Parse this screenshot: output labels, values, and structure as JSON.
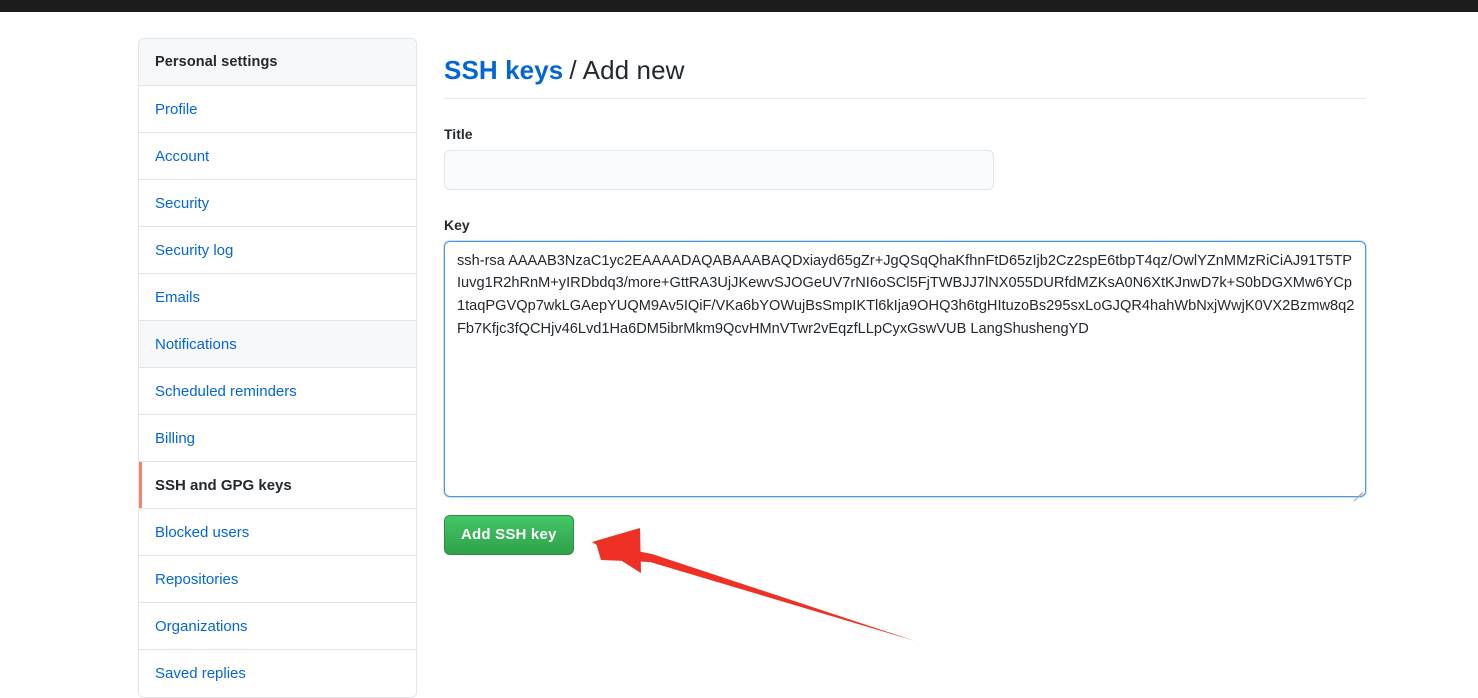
{
  "browser": {
    "chrome_color": "#1c1c1c"
  },
  "sidebar": {
    "header": "Personal settings",
    "items": [
      {
        "label": "Profile",
        "selected": false
      },
      {
        "label": "Account",
        "selected": false
      },
      {
        "label": "Security",
        "selected": false
      },
      {
        "label": "Security log",
        "selected": false
      },
      {
        "label": "Emails",
        "selected": false
      },
      {
        "label": "Notifications",
        "selected": false
      },
      {
        "label": "Scheduled reminders",
        "selected": false
      },
      {
        "label": "Billing",
        "selected": false
      },
      {
        "label": "SSH and GPG keys",
        "selected": true
      },
      {
        "label": "Blocked users",
        "selected": false
      },
      {
        "label": "Repositories",
        "selected": false
      },
      {
        "label": "Organizations",
        "selected": false
      },
      {
        "label": "Saved replies",
        "selected": false
      }
    ],
    "selected_accent": "#f9826c"
  },
  "header": {
    "breadcrumb_link": "SSH keys",
    "breadcrumb_separator": "/",
    "breadcrumb_current": "Add new"
  },
  "form": {
    "title_label": "Title",
    "title_value": "",
    "title_placeholder": "",
    "key_label": "Key",
    "key_value": "ssh-rsa AAAAB3NzaC1yc2EAAAADAQABAAABAQDxiayd65gZr+JgQSqQhaKfhnFtD65zIjb2Cz2spE6tbpT4qz/OwlYZnMMzRiCiAJ91T5TPIuvg1R2hRnM+yIRDbdq3/more+GttRA3UjJKewvSJOGeUV7rNI6oSCl5FjTWBJJ7lNX055DURfdMZKsA0N6XtKJnwD7k+S0bDGXMw6YCp1taqPGVQp7wkLGAepYUQM9Av5IQiF/VKa6bYOWujBsSmpIKTl6kIja9OHQ3h6tgHItuzoBs295sxLoGJQR4hahWbNxjWwjK0VX2Bzmw8q2Fb7Kfjc3fQCHjv46Lvd1Ha6DM5ibrMkm9QcvHMnVTwr2vEqzfLLpCyxGswVUB LangShushengYD",
    "key_focus_border": "#4a9ae0",
    "submit_label": "Add SSH key",
    "submit_color": "#2fa14a"
  },
  "annotation": {
    "arrow_color": "#ee3124",
    "arrow_name": "red-pointer-arrow"
  }
}
